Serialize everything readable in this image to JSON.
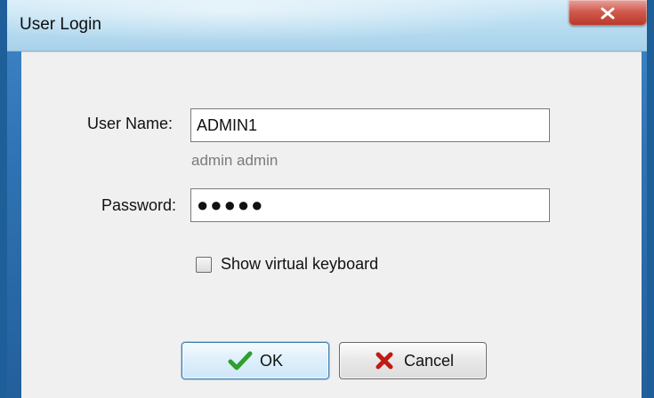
{
  "window": {
    "title": "User Login",
    "close_icon": "close-icon"
  },
  "form": {
    "username": {
      "label": "User Name:",
      "value": "ADMIN1",
      "hint": "admin admin"
    },
    "password": {
      "label": "Password:",
      "value_masked": "●●●●●"
    },
    "virtual_keyboard": {
      "label": "Show virtual keyboard",
      "checked": false
    }
  },
  "buttons": {
    "ok": {
      "label": "OK",
      "icon": "checkmark-icon"
    },
    "cancel": {
      "label": "Cancel",
      "icon": "x-icon"
    }
  },
  "colors": {
    "ok_icon": "#2f9f2f",
    "cancel_icon": "#c11a12",
    "close_button": "#c5483b"
  }
}
